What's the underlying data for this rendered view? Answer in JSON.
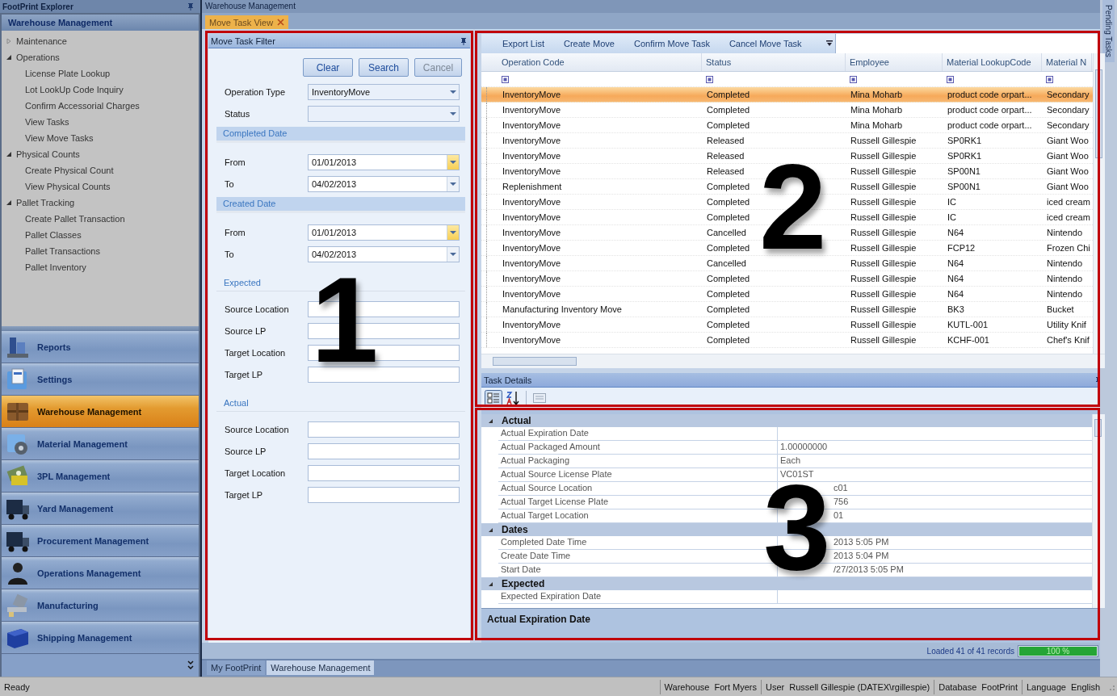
{
  "explorer": {
    "title": "FootPrint Explorer",
    "module": "Warehouse Management",
    "tree": [
      {
        "label": "Maintenance",
        "expanded": false
      },
      {
        "label": "Operations",
        "expanded": true,
        "children": [
          {
            "label": "License Plate Lookup"
          },
          {
            "label": "Lot LookUp Code Inquiry"
          },
          {
            "label": "Confirm Accessorial Charges"
          },
          {
            "label": "View Tasks"
          },
          {
            "label": "View Move Tasks"
          }
        ]
      },
      {
        "label": "Physical Counts",
        "expanded": true,
        "children": [
          {
            "label": "Create Physical Count"
          },
          {
            "label": "View Physical Counts"
          }
        ]
      },
      {
        "label": "Pallet Tracking",
        "expanded": true,
        "children": [
          {
            "label": "Create Pallet Transaction"
          },
          {
            "label": "Pallet Classes"
          },
          {
            "label": "Pallet Transactions"
          },
          {
            "label": "Pallet Inventory"
          }
        ]
      }
    ],
    "nav": [
      {
        "label": "Reports",
        "kind": "building",
        "selected": false
      },
      {
        "label": "Settings",
        "kind": "folder",
        "selected": false
      },
      {
        "label": "Warehouse Management",
        "kind": "box",
        "selected": true
      },
      {
        "label": "Material Management",
        "kind": "gear",
        "selected": false
      },
      {
        "label": "3PL Management",
        "kind": "money",
        "selected": false
      },
      {
        "label": "Yard Management",
        "kind": "truck",
        "selected": false
      },
      {
        "label": "Procurement Management",
        "kind": "truck",
        "selected": false
      },
      {
        "label": "Operations Management",
        "kind": "person",
        "selected": false
      },
      {
        "label": "Manufacturing",
        "kind": "machine",
        "selected": false
      },
      {
        "label": "Shipping Management",
        "kind": "cube",
        "selected": false
      }
    ]
  },
  "document": {
    "title": "Warehouse Management",
    "tabs": [
      {
        "label": "Move Task View",
        "selected": true
      }
    ]
  },
  "filter": {
    "title": "Move Task Filter",
    "buttons": [
      {
        "label": "Clear",
        "disabled": false
      },
      {
        "label": "Search",
        "disabled": false
      },
      {
        "label": "Cancel",
        "disabled": true
      }
    ],
    "fields": [
      {
        "kind": "dropdown",
        "label": "Operation Type",
        "value": "InventoryMove"
      },
      {
        "kind": "dropdown",
        "label": "Status"
      },
      {
        "kind": "band",
        "label": "Completed Date"
      },
      {
        "kind": "date",
        "label": "From",
        "value": "01/01/2013",
        "highlighted": true
      },
      {
        "kind": "date",
        "label": "To",
        "value": "04/02/2013",
        "highlighted": false
      },
      {
        "kind": "band",
        "label": "Created Date"
      },
      {
        "kind": "date",
        "label": "From",
        "value": "01/01/2013",
        "highlighted": true
      },
      {
        "kind": "date",
        "label": "To",
        "value": "04/02/2013",
        "highlighted": false
      },
      {
        "kind": "heading",
        "label": "Expected"
      },
      {
        "kind": "text",
        "label": "Source Location"
      },
      {
        "kind": "text",
        "label": "Source LP"
      },
      {
        "kind": "text",
        "label": "Target Location"
      },
      {
        "kind": "text",
        "label": "Target LP"
      },
      {
        "kind": "heading",
        "label": "Actual"
      },
      {
        "kind": "text",
        "label": "Source Location"
      },
      {
        "kind": "text",
        "label": "Source LP"
      },
      {
        "kind": "text",
        "label": "Target Location"
      },
      {
        "kind": "text",
        "label": "Target LP"
      }
    ]
  },
  "tasks": {
    "toolbar": [
      "Export List",
      "Create Move",
      "Confirm Move Task",
      "Cancel Move Task"
    ],
    "columns": [
      "Operation Code",
      "Status",
      "Employee",
      "Material LookupCode",
      "Material N"
    ],
    "rows": [
      {
        "selected": true,
        "cells": [
          "InventoryMove",
          "Completed",
          "Mina Moharb",
          "product code orpart...",
          "Secondary"
        ]
      },
      {
        "selected": false,
        "cells": [
          "InventoryMove",
          "Completed",
          "Mina Moharb",
          "product code orpart...",
          "Secondary"
        ]
      },
      {
        "selected": false,
        "cells": [
          "InventoryMove",
          "Completed",
          "Mina Moharb",
          "product code orpart...",
          "Secondary"
        ]
      },
      {
        "selected": false,
        "cells": [
          "InventoryMove",
          "Released",
          "Russell Gillespie",
          "SP0RK1",
          "Giant Woo"
        ]
      },
      {
        "selected": false,
        "cells": [
          "InventoryMove",
          "Released",
          "Russell Gillespie",
          "SP0RK1",
          "Giant Woo"
        ]
      },
      {
        "selected": false,
        "cells": [
          "InventoryMove",
          "Released",
          "Russell Gillespie",
          "SP00N1",
          "Giant Woo"
        ]
      },
      {
        "selected": false,
        "cells": [
          "Replenishment",
          "Completed",
          "Russell Gillespie",
          "SP00N1",
          "Giant Woo"
        ]
      },
      {
        "selected": false,
        "cells": [
          "InventoryMove",
          "Completed",
          "Russell Gillespie",
          "IC",
          "iced cream"
        ]
      },
      {
        "selected": false,
        "cells": [
          "InventoryMove",
          "Completed",
          "Russell Gillespie",
          "IC",
          "iced cream"
        ]
      },
      {
        "selected": false,
        "cells": [
          "InventoryMove",
          "Cancelled",
          "Russell Gillespie",
          "N64",
          "Nintendo"
        ]
      },
      {
        "selected": false,
        "cells": [
          "InventoryMove",
          "Completed",
          "Russell Gillespie",
          "FCP12",
          "Frozen Chi"
        ]
      },
      {
        "selected": false,
        "cells": [
          "InventoryMove",
          "Cancelled",
          "Russell Gillespie",
          "N64",
          "Nintendo"
        ]
      },
      {
        "selected": false,
        "cells": [
          "InventoryMove",
          "Completed",
          "Russell Gillespie",
          "N64",
          "Nintendo"
        ]
      },
      {
        "selected": false,
        "cells": [
          "InventoryMove",
          "Completed",
          "Russell Gillespie",
          "N64",
          "Nintendo"
        ]
      },
      {
        "selected": false,
        "cells": [
          "Manufacturing Inventory Move",
          "Completed",
          "Russell Gillespie",
          "BK3",
          "Bucket"
        ]
      },
      {
        "selected": false,
        "cells": [
          "InventoryMove",
          "Completed",
          "Russell Gillespie",
          "KUTL-001",
          "Utility Knif"
        ]
      },
      {
        "selected": false,
        "cells": [
          "InventoryMove",
          "Completed",
          "Russell Gillespie",
          "KCHF-001",
          "Chef's Knif"
        ]
      }
    ]
  },
  "details": {
    "title": "Task Details",
    "groups": [
      {
        "label": "Actual",
        "expanded": true,
        "rows": [
          {
            "name": "Actual Expiration Date"
          },
          {
            "name": "Actual Packaged Amount",
            "before": "1.00000000"
          },
          {
            "name": "Actual Packaging",
            "before": "Each"
          },
          {
            "name": "Actual Source License Plate",
            "before": "VC01ST"
          },
          {
            "name": "Actual Source Location",
            "after": "c01"
          },
          {
            "name": "Actual Target License Plate",
            "after": "756"
          },
          {
            "name": "Actual Target Location",
            "after": "01"
          }
        ]
      },
      {
        "label": "Dates",
        "expanded": true,
        "rows": [
          {
            "name": "Completed Date Time",
            "after": "2013 5:05 PM"
          },
          {
            "name": "Create Date Time",
            "after": "2013 5:04 PM"
          },
          {
            "name": "Start Date",
            "after": "/27/2013 5:05 PM"
          }
        ]
      },
      {
        "label": "Expected",
        "expanded": true,
        "rows": [
          {
            "name": "Expected Expiration Date"
          }
        ]
      }
    ],
    "description": "Actual Expiration Date"
  },
  "load_status": {
    "text": "Loaded 41 of 41 records",
    "progress": {
      "level": 1,
      "label": "100 %"
    }
  },
  "bottom_tabs": [
    {
      "label": "My FootPrint",
      "selected": false
    },
    {
      "label": "Warehouse Management",
      "selected": true
    }
  ],
  "side_tab": "Pending Tasks",
  "status_bar": {
    "text": "Ready",
    "fields": [
      {
        "label": "Warehouse",
        "value": "Fort Myers"
      },
      {
        "label": "User",
        "value": "Russell Gillespie (DATEX\\rgillespie)"
      },
      {
        "label": "Database",
        "value": "FootPrint"
      },
      {
        "label": "Language",
        "value": "English"
      }
    ]
  },
  "callouts": [
    {
      "label": "1"
    },
    {
      "label": "2"
    },
    {
      "label": "3"
    }
  ]
}
